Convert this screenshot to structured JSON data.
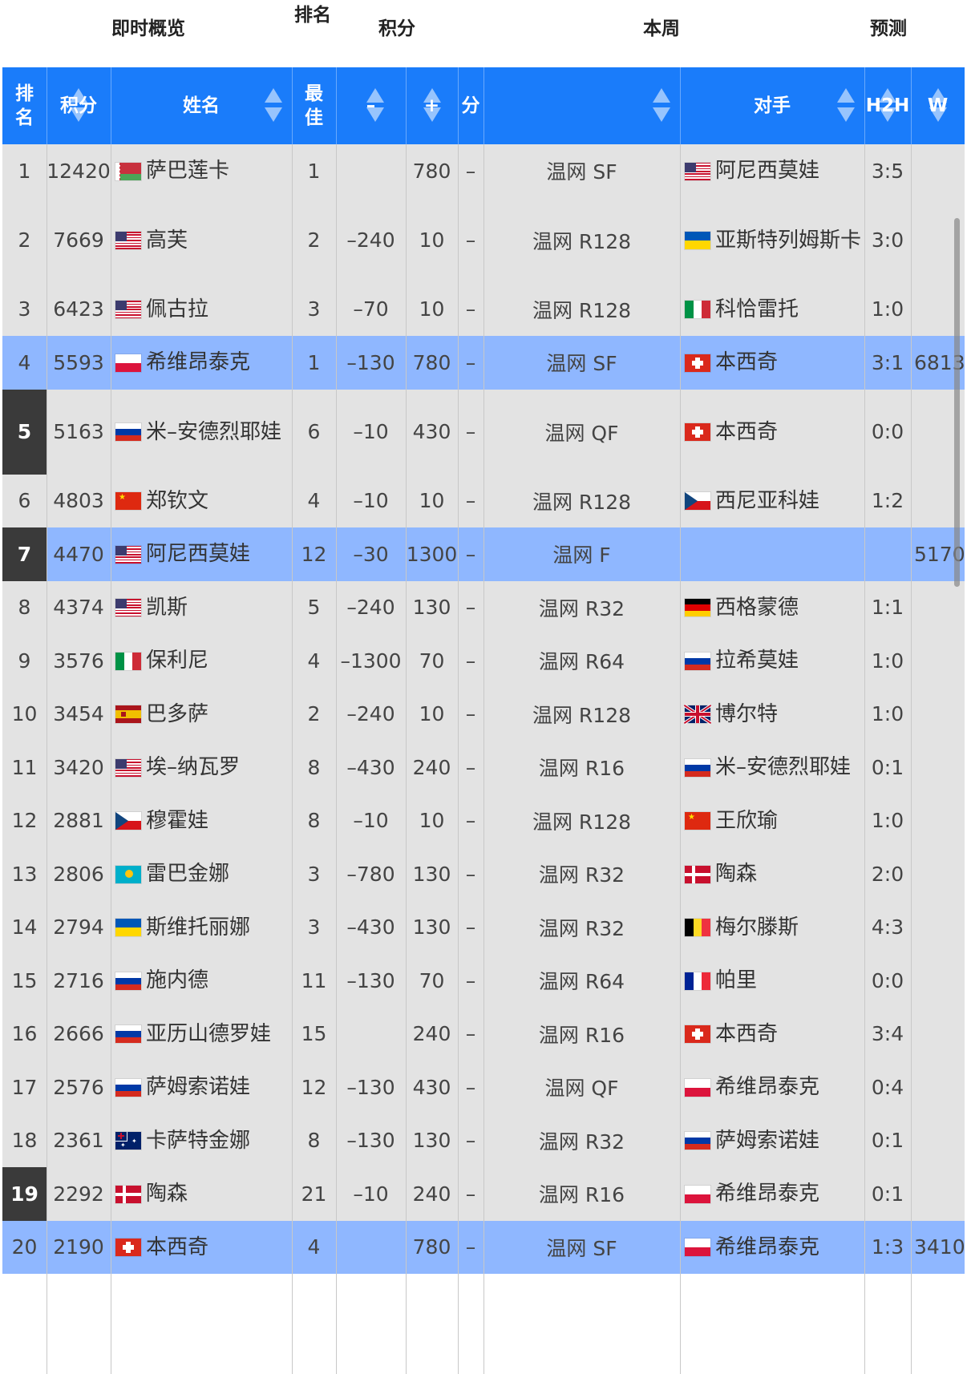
{
  "group_header": {
    "overview": "即时概览",
    "rank": "排名",
    "points": "积分",
    "this_week": "本周",
    "forecast": "预测"
  },
  "columns": {
    "rank": "排名",
    "points": "积分",
    "name": "姓名",
    "best": "最佳",
    "minus": "–",
    "plus": "+",
    "score": "分",
    "round": "",
    "opponent": "对手",
    "h2h": "H2H",
    "w": "W"
  },
  "colors": {
    "header_blue": "#1a7cfa",
    "row_gray": "#e3e3e3",
    "row_highlight": "#8fb7ff",
    "rank_dark": "#3a3a3a"
  },
  "rows": [
    {
      "rank": "1",
      "points": "12420",
      "flag": "blr",
      "name": "萨巴莲卡",
      "best": "1",
      "minus": "",
      "plus": "780",
      "score": "–",
      "round": "温网 SF",
      "opp_flag": "usa",
      "opponent": "阿尼西莫娃",
      "h2h": "3:5",
      "w": "",
      "style": "normal"
    },
    {
      "rank": "2",
      "points": "7669",
      "flag": "usa",
      "name": "高芙",
      "best": "2",
      "minus": "–240",
      "plus": "10",
      "score": "–",
      "round": "温网 R128",
      "opp_flag": "ukr",
      "opponent": "亚斯特列姆斯卡",
      "h2h": "3:0",
      "w": "",
      "style": "normal"
    },
    {
      "rank": "3",
      "points": "6423",
      "flag": "usa",
      "name": "佩古拉",
      "best": "3",
      "minus": "–70",
      "plus": "10",
      "score": "–",
      "round": "温网 R128",
      "opp_flag": "ita",
      "opponent": "科恰雷托",
      "h2h": "1:0",
      "w": "",
      "style": "normal"
    },
    {
      "rank": "4",
      "points": "5593",
      "flag": "pol",
      "name": "希维昂泰克",
      "best": "1",
      "minus": "–130",
      "plus": "780",
      "score": "–",
      "round": "温网 SF",
      "opp_flag": "sui",
      "opponent": "本西奇",
      "h2h": "3:1",
      "w": "6813",
      "style": "highlight"
    },
    {
      "rank": "5",
      "points": "5163",
      "flag": "rus",
      "name": "米–安德烈耶娃",
      "best": "6",
      "minus": "–10",
      "plus": "430",
      "score": "–",
      "round": "温网 QF",
      "opp_flag": "sui",
      "opponent": "本西奇",
      "h2h": "0:0",
      "w": "",
      "style": "darkrank"
    },
    {
      "rank": "6",
      "points": "4803",
      "flag": "chn",
      "name": "郑钦文",
      "best": "4",
      "minus": "–10",
      "plus": "10",
      "score": "–",
      "round": "温网 R128",
      "opp_flag": "cze",
      "opponent": "西尼亚科娃",
      "h2h": "1:2",
      "w": "",
      "style": "normal"
    },
    {
      "rank": "7",
      "points": "4470",
      "flag": "usa",
      "name": "阿尼西莫娃",
      "best": "12",
      "minus": "–30",
      "plus": "1300",
      "score": "–",
      "round": "温网 F",
      "opp_flag": "",
      "opponent": "",
      "h2h": "",
      "w": "5170",
      "style": "highlight-dark"
    },
    {
      "rank": "8",
      "points": "4374",
      "flag": "usa",
      "name": "凯斯",
      "best": "5",
      "minus": "–240",
      "plus": "130",
      "score": "–",
      "round": "温网 R32",
      "opp_flag": "ger",
      "opponent": "西格蒙德",
      "h2h": "1:1",
      "w": "",
      "style": "normal"
    },
    {
      "rank": "9",
      "points": "3576",
      "flag": "ita",
      "name": "保利尼",
      "best": "4",
      "minus": "–1300",
      "plus": "70",
      "score": "–",
      "round": "温网 R64",
      "opp_flag": "rus",
      "opponent": "拉希莫娃",
      "h2h": "1:0",
      "w": "",
      "style": "normal"
    },
    {
      "rank": "10",
      "points": "3454",
      "flag": "esp",
      "name": "巴多萨",
      "best": "2",
      "minus": "–240",
      "plus": "10",
      "score": "–",
      "round": "温网 R128",
      "opp_flag": "gbr",
      "opponent": "博尔特",
      "h2h": "1:0",
      "w": "",
      "style": "normal"
    },
    {
      "rank": "11",
      "points": "3420",
      "flag": "usa",
      "name": "埃–纳瓦罗",
      "best": "8",
      "minus": "–430",
      "plus": "240",
      "score": "–",
      "round": "温网 R16",
      "opp_flag": "rus",
      "opponent": "米–安德烈耶娃",
      "h2h": "0:1",
      "w": "",
      "style": "normal"
    },
    {
      "rank": "12",
      "points": "2881",
      "flag": "cze",
      "name": "穆霍娃",
      "best": "8",
      "minus": "–10",
      "plus": "10",
      "score": "–",
      "round": "温网 R128",
      "opp_flag": "chn",
      "opponent": "王欣瑜",
      "h2h": "1:0",
      "w": "",
      "style": "normal"
    },
    {
      "rank": "13",
      "points": "2806",
      "flag": "kaz",
      "name": "雷巴金娜",
      "best": "3",
      "minus": "–780",
      "plus": "130",
      "score": "–",
      "round": "温网 R32",
      "opp_flag": "den",
      "opponent": "陶森",
      "h2h": "2:0",
      "w": "",
      "style": "normal"
    },
    {
      "rank": "14",
      "points": "2794",
      "flag": "ukr",
      "name": "斯维托丽娜",
      "best": "3",
      "minus": "–430",
      "plus": "130",
      "score": "–",
      "round": "温网 R32",
      "opp_flag": "bel",
      "opponent": "梅尔滕斯",
      "h2h": "4:3",
      "w": "",
      "style": "normal"
    },
    {
      "rank": "15",
      "points": "2716",
      "flag": "rus",
      "name": "施内德",
      "best": "11",
      "minus": "–130",
      "plus": "70",
      "score": "–",
      "round": "温网 R64",
      "opp_flag": "fra",
      "opponent": "帕里",
      "h2h": "0:0",
      "w": "",
      "style": "normal"
    },
    {
      "rank": "16",
      "points": "2666",
      "flag": "rus",
      "name": "亚历山德罗娃",
      "best": "15",
      "minus": "",
      "plus": "240",
      "score": "–",
      "round": "温网 R16",
      "opp_flag": "sui",
      "opponent": "本西奇",
      "h2h": "3:4",
      "w": "",
      "style": "normal"
    },
    {
      "rank": "17",
      "points": "2576",
      "flag": "rus",
      "name": "萨姆索诺娃",
      "best": "12",
      "minus": "–130",
      "plus": "430",
      "score": "–",
      "round": "温网 QF",
      "opp_flag": "pol",
      "opponent": "希维昂泰克",
      "h2h": "0:4",
      "w": "",
      "style": "normal"
    },
    {
      "rank": "18",
      "points": "2361",
      "flag": "aus",
      "name": "卡萨特金娜",
      "best": "8",
      "minus": "–130",
      "plus": "130",
      "score": "–",
      "round": "温网 R32",
      "opp_flag": "rus",
      "opponent": "萨姆索诺娃",
      "h2h": "0:1",
      "w": "",
      "style": "normal"
    },
    {
      "rank": "19",
      "points": "2292",
      "flag": "den",
      "name": "陶森",
      "best": "21",
      "minus": "–10",
      "plus": "240",
      "score": "–",
      "round": "温网 R16",
      "opp_flag": "pol",
      "opponent": "希维昂泰克",
      "h2h": "0:1",
      "w": "",
      "style": "darkrank"
    },
    {
      "rank": "20",
      "points": "2190",
      "flag": "sui",
      "name": "本西奇",
      "best": "4",
      "minus": "",
      "plus": "780",
      "score": "–",
      "round": "温网 SF",
      "opp_flag": "pol",
      "opponent": "希维昂泰克",
      "h2h": "1:3",
      "w": "3410",
      "style": "highlight"
    }
  ]
}
